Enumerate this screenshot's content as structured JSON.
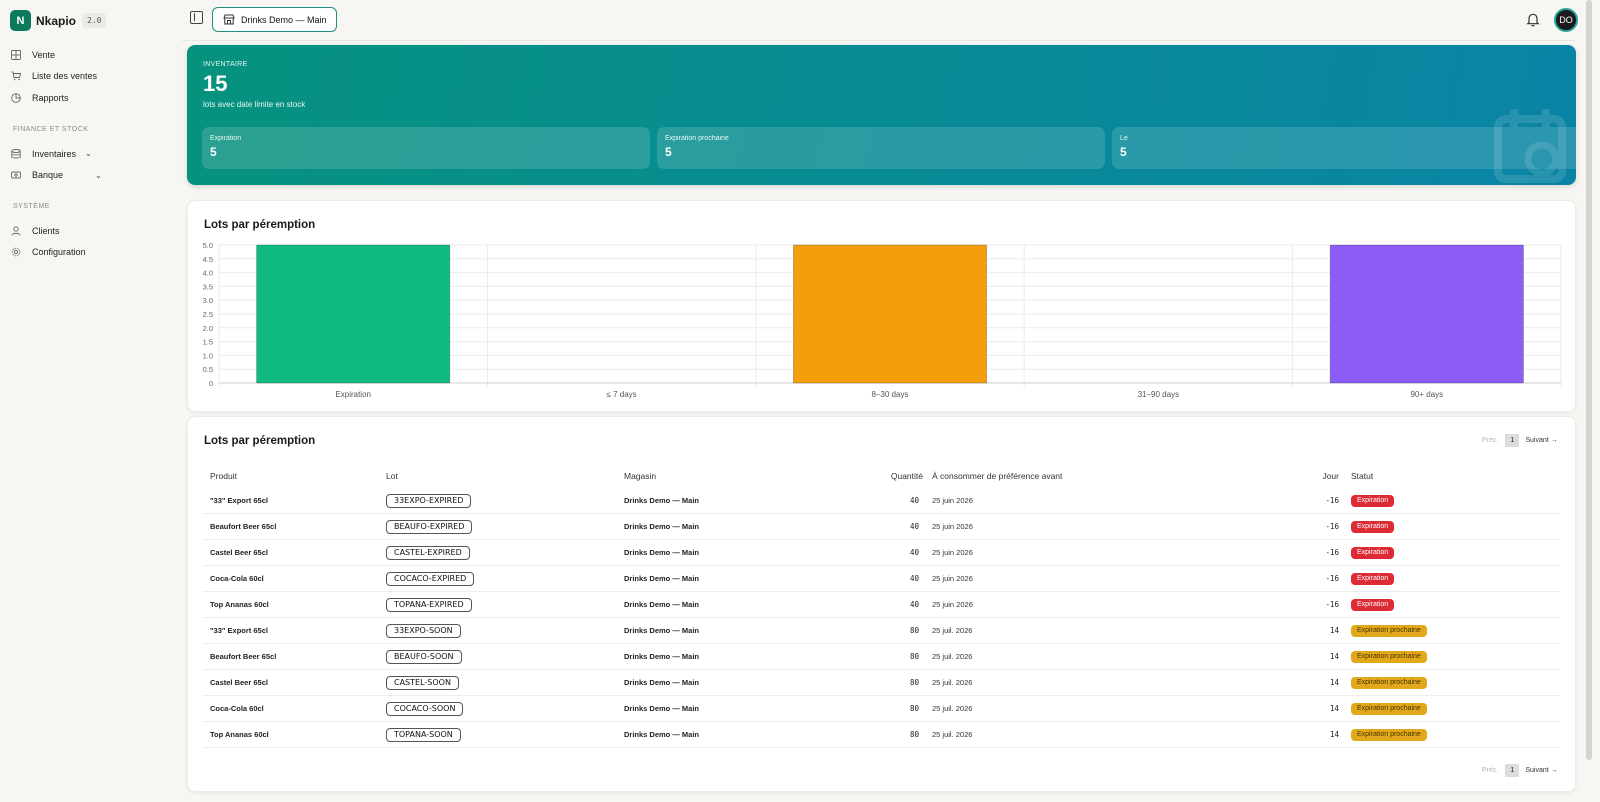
{
  "app": {
    "name": "Nkapio",
    "version": "2.0"
  },
  "sidebar": {
    "top_items": [
      {
        "label": "Vente",
        "icon": "grid-icon"
      },
      {
        "label": "Liste des ventes",
        "icon": "cart-icon"
      },
      {
        "label": "Rapports",
        "icon": "pie-chart-icon"
      }
    ],
    "section_finance": "FINANCE ET STOCK",
    "finance_items": [
      {
        "label": "Inventaires",
        "icon": "database-icon"
      },
      {
        "label": "Banque",
        "icon": "banknote-icon"
      }
    ],
    "section_system": "SYSTÈME",
    "system_items": [
      {
        "label": "Clients",
        "icon": "user-icon"
      },
      {
        "label": "Configuration",
        "icon": "gear-icon"
      }
    ]
  },
  "header": {
    "store": "Drinks Demo — Main",
    "avatar_initials": "DO"
  },
  "hero": {
    "kicker": "INVENTAIRE",
    "value": "15",
    "subtitle": "lots avec date limite en stock",
    "stats": [
      {
        "label": "Expiration",
        "value": "5"
      },
      {
        "label": "Expiration prochaine",
        "value": "5"
      },
      {
        "label": "Le",
        "value": "5"
      }
    ]
  },
  "chart_data": {
    "type": "bar",
    "title": "Lots par péremption",
    "categories": [
      "Expiration",
      "≤ 7 days",
      "8–30 days",
      "31–90 days",
      "90+ days"
    ],
    "values": [
      5,
      0,
      5,
      0,
      5
    ],
    "colors": [
      "#10b981",
      "#10b981",
      "#f59e0b",
      "#f59e0b",
      "#8b5cf6"
    ],
    "ylim": [
      0,
      5
    ],
    "yticks": [
      "5.0",
      "4.5",
      "4.0",
      "3.5",
      "3.0",
      "2.5",
      "2.0",
      "1.5",
      "1.0",
      "0.5",
      "0"
    ],
    "xlabel": "",
    "ylabel": "",
    "grid": true
  },
  "table": {
    "title": "Lots par péremption",
    "pager": {
      "prev": "Préc.",
      "page": "1",
      "next": "Suivant →"
    },
    "columns": [
      "Produit",
      "Lot",
      "Magasin",
      "Quantité",
      "À consommer de préférence avant",
      "Jour",
      "Statut"
    ],
    "rows": [
      {
        "product": "\"33\" Export 65cl",
        "lot": "33EXPO-EXPIRED",
        "store": "Drinks Demo — Main",
        "qty": "40",
        "date": "25 juin 2026",
        "day": "-16",
        "status": "Expiration",
        "kind": "exp"
      },
      {
        "product": "Beaufort Beer 65cl",
        "lot": "BEAUFO-EXPIRED",
        "store": "Drinks Demo — Main",
        "qty": "40",
        "date": "25 juin 2026",
        "day": "-16",
        "status": "Expiration",
        "kind": "exp"
      },
      {
        "product": "Castel Beer 65cl",
        "lot": "CASTEL-EXPIRED",
        "store": "Drinks Demo — Main",
        "qty": "40",
        "date": "25 juin 2026",
        "day": "-16",
        "status": "Expiration",
        "kind": "exp"
      },
      {
        "product": "Coca-Cola 60cl",
        "lot": "COCACO-EXPIRED",
        "store": "Drinks Demo — Main",
        "qty": "40",
        "date": "25 juin 2026",
        "day": "-16",
        "status": "Expiration",
        "kind": "exp"
      },
      {
        "product": "Top Ananas 60cl",
        "lot": "TOPANA-EXPIRED",
        "store": "Drinks Demo — Main",
        "qty": "40",
        "date": "25 juin 2026",
        "day": "-16",
        "status": "Expiration",
        "kind": "exp"
      },
      {
        "product": "\"33\" Export 65cl",
        "lot": "33EXPO-SOON",
        "store": "Drinks Demo — Main",
        "qty": "80",
        "date": "25 juil. 2026",
        "day": "14",
        "status": "Expiration prochaine",
        "kind": "soon"
      },
      {
        "product": "Beaufort Beer 65cl",
        "lot": "BEAUFO-SOON",
        "store": "Drinks Demo — Main",
        "qty": "80",
        "date": "25 juil. 2026",
        "day": "14",
        "status": "Expiration prochaine",
        "kind": "soon"
      },
      {
        "product": "Castel Beer 65cl",
        "lot": "CASTEL-SOON",
        "store": "Drinks Demo — Main",
        "qty": "80",
        "date": "25 juil. 2026",
        "day": "14",
        "status": "Expiration prochaine",
        "kind": "soon"
      },
      {
        "product": "Coca-Cola 60cl",
        "lot": "COCACO-SOON",
        "store": "Drinks Demo — Main",
        "qty": "80",
        "date": "25 juil. 2026",
        "day": "14",
        "status": "Expiration prochaine",
        "kind": "soon"
      },
      {
        "product": "Top Ananas 60cl",
        "lot": "TOPANA-SOON",
        "store": "Drinks Demo — Main",
        "qty": "80",
        "date": "25 juil. 2026",
        "day": "14",
        "status": "Expiration prochaine",
        "kind": "soon"
      }
    ]
  }
}
